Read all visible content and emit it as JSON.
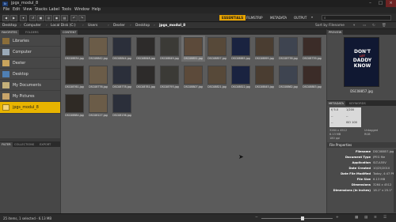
{
  "app": {
    "title": "jpgs_modul_8",
    "icon_label": "Br",
    "window_controls": [
      "minimize-icon",
      "maximize-icon",
      "close-icon"
    ]
  },
  "menu": [
    "File",
    "Edit",
    "View",
    "Stacks",
    "Label",
    "Tools",
    "Window",
    "Help"
  ],
  "toolbar": {
    "workspaces": [
      "ESSENTIALS",
      "FILMSTRIP",
      "METADATA",
      "OUTPUT"
    ],
    "active_workspace": "ESSENTIALS",
    "search_placeholder": ""
  },
  "path": {
    "crumbs": [
      "Desktop",
      "Computer",
      "Local Disk (C:)",
      "Users",
      "Dexter",
      "Desktop",
      "jpgs_modul_8"
    ],
    "sort_label": "Sort by Filename"
  },
  "left_panel": {
    "tabs": [
      "FAVORITES",
      "FOLDERS"
    ],
    "items": [
      {
        "label": "Libraries",
        "icon": "libraries-icon"
      },
      {
        "label": "Computer",
        "icon": "computer-icon"
      },
      {
        "label": "Dexter",
        "icon": "user-folder-icon"
      },
      {
        "label": "Desktop",
        "icon": "desktop-icon"
      },
      {
        "label": "My Documents",
        "icon": "documents-icon"
      },
      {
        "label": "My Pictures",
        "icon": "pictures-icon"
      },
      {
        "label": "jpgs_modul_8",
        "icon": "folder-icon",
        "selected": true
      }
    ],
    "bottom_tabs": [
      "FILTER",
      "COLLECTIONS",
      "EXPORT"
    ]
  },
  "content": {
    "tab": "CONTENT",
    "files": [
      "DSC08834.jpg",
      "DSC08842.jpg",
      "DSC08844.jpg",
      "DSC08848.jpg",
      "DSC08849.jpg",
      "DSC08851.jpg",
      "DSC08857.jpg",
      "DSC08885.jpg",
      "DSC08895.jpg",
      "DSC08738.jpg",
      "DSC08739.jpg",
      "DSC08761.jpg",
      "DSC08776.jpg",
      "DSC08778.jpg",
      "DSC08781.jpg",
      "DSC08793.jpg",
      "DSC08807.jpg",
      "DSC08821.jpg",
      "DSC08822.jpg",
      "DSC08845.jpg",
      "DSC08862.jpg",
      "DSC08883.jpg",
      "DSC08884.jpg",
      "DSC08127.jpg",
      "DSC08136.jpg"
    ],
    "selected_index": 5
  },
  "right_panel": {
    "preview_tab": "PREVIEW",
    "preview_caption": "DSC08857.jpg",
    "poster_text": [
      "DON'T",
      "LET",
      "DADDY",
      "KNOW"
    ],
    "metadata_tabs": [
      "METADATA",
      "KEYWORDS"
    ],
    "camera": [
      "f/ 5.0",
      "1/200",
      "--",
      "--",
      "ISO 100",
      "--"
    ],
    "dims": "3264 x 4512",
    "size": "6.13 MB",
    "dpi": "180 ppi",
    "color": "Untagged",
    "mode": "RGB",
    "file_props_title": "File Properties",
    "props": [
      {
        "k": "Filename",
        "v": "DSC08857.jpg"
      },
      {
        "k": "Document Type",
        "v": "JPEG file"
      },
      {
        "k": "Application",
        "v": "SLT-A55V"
      },
      {
        "k": "Date Created",
        "v": "10/25/2010"
      },
      {
        "k": "Date File Modified",
        "v": "Today, 4:47 PM"
      },
      {
        "k": "File Size",
        "v": "6.13 MB"
      },
      {
        "k": "Dimensions",
        "v": "3264 x 4512"
      },
      {
        "k": "Dimensions (in inches)",
        "v": "18.1\" x 25.1\""
      }
    ]
  },
  "status": {
    "text": "25 items, 1 selected - 6.13 MB",
    "zoom": 0.58
  },
  "colors": {
    "accent": "#e8a400",
    "panel": "#474747",
    "content_bg": "#5b5b5b"
  }
}
